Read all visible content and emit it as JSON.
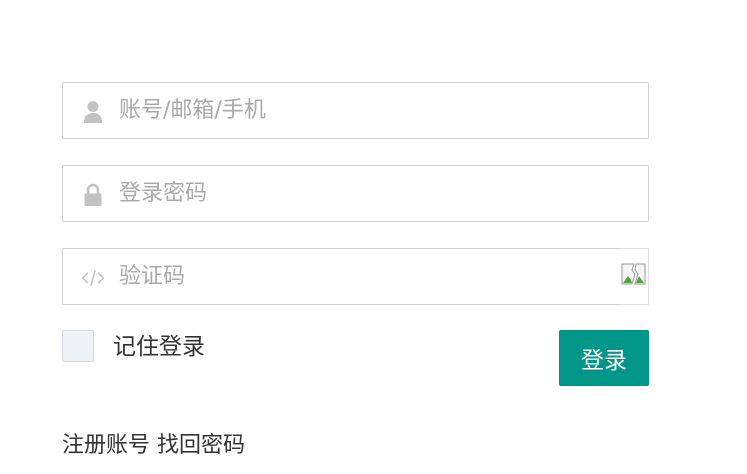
{
  "login": {
    "account_placeholder": "账号/邮箱/手机",
    "password_placeholder": "登录密码",
    "captcha_placeholder": "验证码",
    "remember_label": "记住登录",
    "login_button": "登录",
    "register_link": "注册账号",
    "forgot_link": "找回密码"
  },
  "icons": {
    "account": "user-icon",
    "password": "lock-icon",
    "captcha": "code-icon",
    "captcha_image": "broken-image-icon"
  },
  "colors": {
    "primary": "#009688",
    "icon": "#c2c2c2",
    "border": "#d2d2d2",
    "placeholder": "#a9a9a9"
  }
}
